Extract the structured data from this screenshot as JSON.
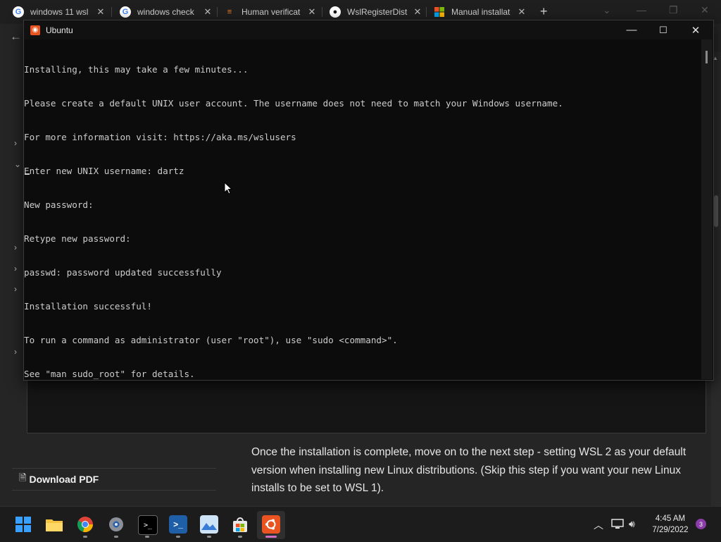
{
  "browser": {
    "tabs": [
      {
        "title": "windows 11 wsl",
        "icon": "google-icon",
        "close": "✕"
      },
      {
        "title": "windows check",
        "icon": "google-icon",
        "close": "✕"
      },
      {
        "title": "Human verificat",
        "icon": "stackoverflow-icon",
        "close": "✕"
      },
      {
        "title": "WslRegisterDist",
        "icon": "github-icon",
        "close": "✕"
      },
      {
        "title": "Manual installat",
        "icon": "microsoft-icon",
        "close": "✕"
      }
    ],
    "new_tab": "+"
  },
  "page": {
    "download_label": "Download PDF",
    "article_text": "Once the installation is complete, move on to the next step - setting WSL 2 as your default version when installing new Linux distributions. (Skip this step if you want your new Linux installs to be set to WSL 1)."
  },
  "terminal": {
    "title": "Ubuntu",
    "lines": [
      "Installing, this may take a few minutes...",
      "Please create a default UNIX user account. The username does not need to match your Windows username.",
      "For more information visit: https://aka.ms/wslusers",
      "Enter new UNIX username: dartz",
      "New password:",
      "Retype new password:",
      "passwd: password updated successfully",
      "Installation successful!",
      "To run a command as administrator (user \"root\"), use \"sudo <command>\".",
      "See \"man sudo_root\" for details."
    ]
  },
  "taskbar": {
    "apps": [
      "start-icon",
      "file-explorer-icon",
      "chrome-icon",
      "settings-icon",
      "terminal-icon",
      "powershell-icon",
      "photos-icon",
      "store-icon",
      "ubuntu-icon"
    ],
    "time": "4:45 AM",
    "date": "7/29/2022",
    "notification_count": "3"
  },
  "colors": {
    "ubuntu_orange": "#e95420",
    "terminal_bg": "#0c0c0c",
    "taskbar_bg": "#1c1c1c"
  }
}
